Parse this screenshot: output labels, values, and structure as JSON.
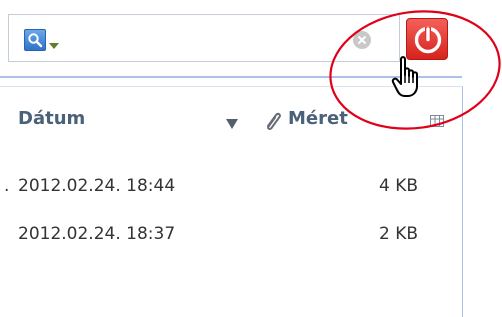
{
  "search": {
    "value": "",
    "placeholder": ""
  },
  "table": {
    "columns": {
      "date": "Dátum",
      "size": "Méret"
    },
    "rows": [
      {
        "prefix": ".",
        "date": "2012.02.24. 18:44",
        "size": "4 KB"
      },
      {
        "prefix": "",
        "date": "2012.02.24. 18:37",
        "size": "2 KB"
      }
    ]
  },
  "icons": {
    "search_scope": "magnifier-icon",
    "clear": "clear-icon",
    "power": "power-icon",
    "sort": "sort-desc-icon",
    "attachment": "paperclip-icon",
    "column_chooser": "column-chooser-icon",
    "cursor": "hand-pointer-icon"
  },
  "colors": {
    "accent_blue": "#a9c2e6",
    "power_red": "#d6231c",
    "annotation_red": "#e0001a",
    "header_text": "#4b6079"
  }
}
